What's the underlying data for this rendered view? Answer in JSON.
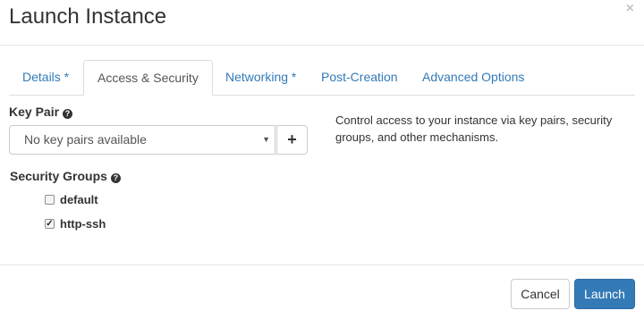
{
  "dialog": {
    "title": "Launch Instance",
    "close_label": "×"
  },
  "tabs": [
    {
      "label": "Details *",
      "active": false
    },
    {
      "label": "Access & Security",
      "active": true
    },
    {
      "label": "Networking *",
      "active": false
    },
    {
      "label": "Post-Creation",
      "active": false
    },
    {
      "label": "Advanced Options",
      "active": false
    }
  ],
  "key_pair": {
    "label": "Key Pair",
    "help_icon": "question-circle-icon",
    "selected_value": "No key pairs available",
    "add_button_label": "+"
  },
  "help_text": "Control access to your instance via key pairs, security groups, and other mechanisms.",
  "security_groups": {
    "label": "Security Groups",
    "help_icon": "question-circle-icon",
    "options": [
      {
        "label": "default",
        "checked": false
      },
      {
        "label": "http-ssh",
        "checked": true
      }
    ]
  },
  "footer": {
    "cancel_label": "Cancel",
    "launch_label": "Launch"
  },
  "colors": {
    "primary": "#337ab7",
    "link": "#337ab7"
  }
}
